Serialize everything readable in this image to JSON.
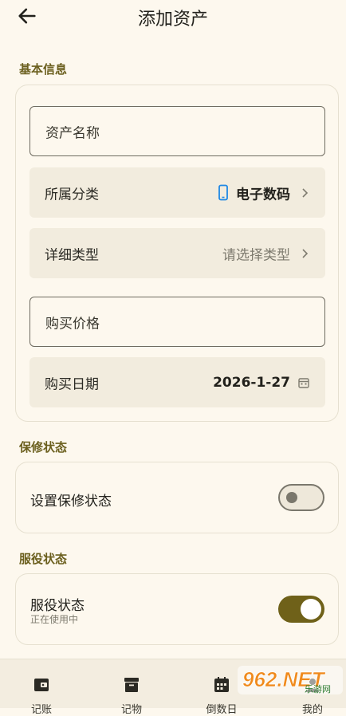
{
  "header": {
    "title": "添加资产"
  },
  "basic": {
    "section_label": "基本信息",
    "name_field": {
      "placeholder": "资产名称"
    },
    "category": {
      "label": "所属分类",
      "value": "电子数码",
      "icon": "phone-icon"
    },
    "detail_type": {
      "label": "详细类型",
      "value": "请选择类型"
    },
    "price_field": {
      "placeholder": "购买价格"
    },
    "purchase_date": {
      "label": "购买日期",
      "value": "2026-1-27"
    }
  },
  "warranty": {
    "section_label": "保修状态",
    "toggle_label": "设置保修状态",
    "enabled": false
  },
  "service": {
    "section_label": "服役状态",
    "toggle_label": "服役状态",
    "sub_label": "正在使用中",
    "enabled": true
  },
  "bottom_nav": {
    "items": [
      {
        "label": "记账",
        "icon": "wallet-icon"
      },
      {
        "label": "记物",
        "icon": "archive-box-icon"
      },
      {
        "label": "倒数日",
        "icon": "calendar-icon"
      },
      {
        "label": "我的",
        "icon": "person-icon"
      }
    ]
  },
  "watermark": {
    "text": "962.NET",
    "sub": "乐游网"
  },
  "colors": {
    "background": "#FDF8EE",
    "accent": "#6F6119",
    "section_label": "#6B5F1E",
    "filled_field": "#F2ECDE"
  }
}
